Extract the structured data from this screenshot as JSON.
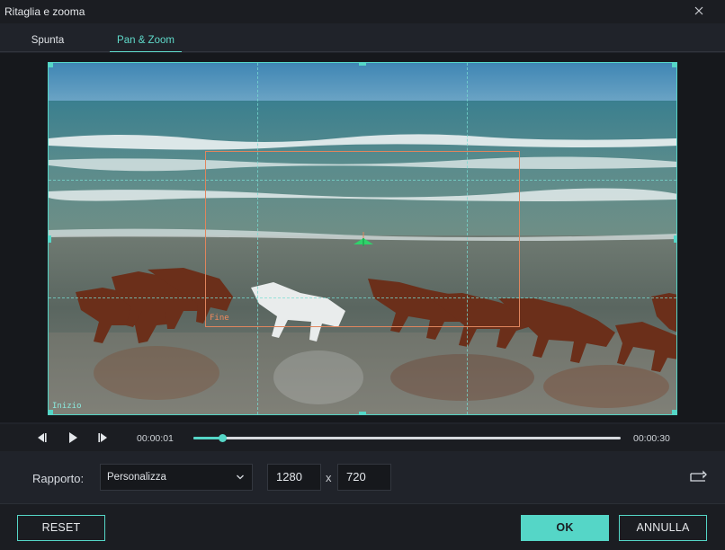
{
  "window": {
    "title": "Ritaglia e zooma"
  },
  "tabs": [
    {
      "label": "Spunta",
      "active": false
    },
    {
      "label": "Pan & Zoom",
      "active": true
    }
  ],
  "preview": {
    "start_label": "Inizio",
    "end_label": "Fine"
  },
  "player": {
    "current_time": "00:00:01",
    "total_time": "00:00:30",
    "progress_fraction": 0.068
  },
  "ratio": {
    "label": "Rapporto:",
    "selected": "Personalizza",
    "width": "1280",
    "separator": "x",
    "height": "720"
  },
  "footer": {
    "reset_label": "RESET",
    "ok_label": "OK",
    "cancel_label": "ANNULLA"
  },
  "colors": {
    "accent": "#55d6c7",
    "end_box": "#e0855d",
    "background": "#20232a"
  }
}
